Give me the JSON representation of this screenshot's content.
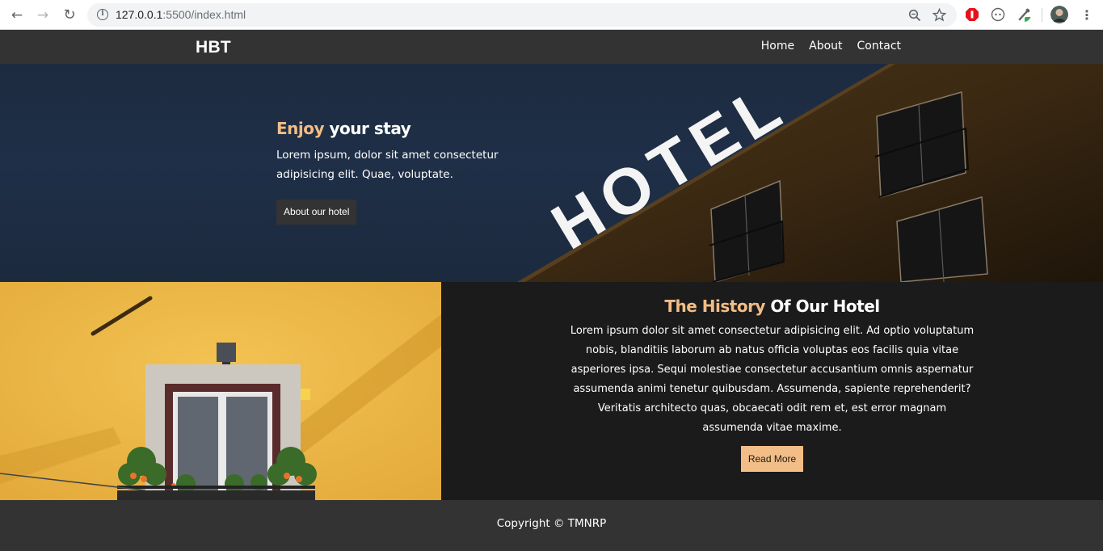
{
  "browser": {
    "url_host": "127.0.0.1",
    "url_rest": ":5500/index.html"
  },
  "header": {
    "logo": "HBT",
    "nav": [
      "Home",
      "About",
      "Contact"
    ]
  },
  "hero": {
    "title_accent": "Enjoy",
    "title_rest": " your stay",
    "text": "Lorem ipsum, dolor sit amet consectetur adipisicing elit. Quae, voluptate.",
    "button": "About our hotel",
    "sign": "HOTEL"
  },
  "history": {
    "title_accent": "The History",
    "title_rest": " Of Our Hotel",
    "text": "Lorem ipsum dolor sit amet consectetur adipisicing elit. Ad optio voluptatum nobis, blanditiis laborum ab natus officia voluptas eos facilis quia vitae asperiores ipsa. Sequi molestiae consectetur accusantium omnis aspernatur assumenda animi tenetur quibusdam. Assumenda, sapiente reprehenderit? Veritatis architecto quas, obcaecati odit rem et, est error magnam assumenda vitae maxime.",
    "button": "Read More"
  },
  "footer": {
    "text": "Copyright © TMNRP"
  },
  "colors": {
    "accent": "#f2bd86",
    "header_bg": "#333333",
    "section_bg": "#1b1b1b"
  }
}
